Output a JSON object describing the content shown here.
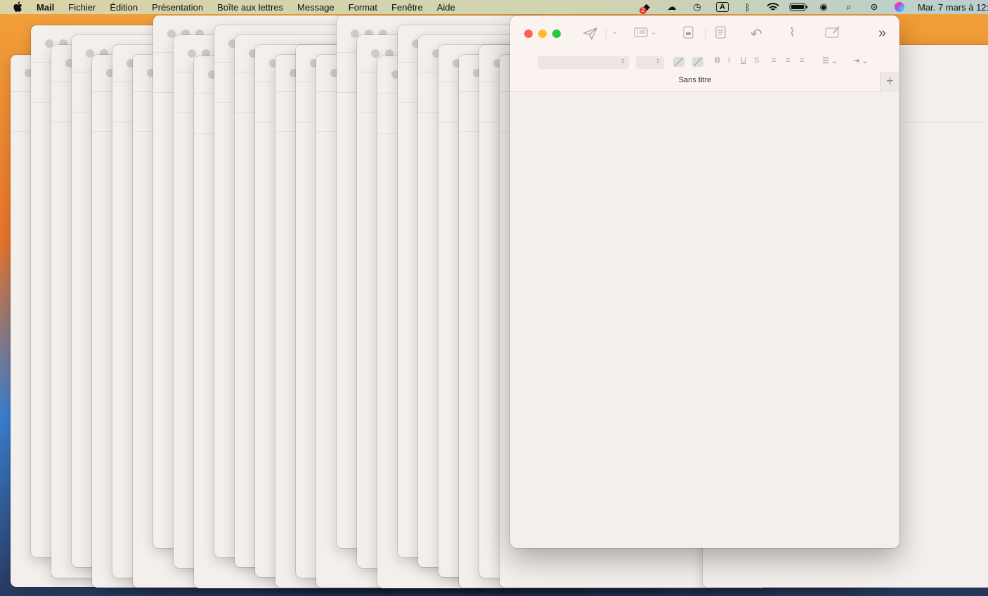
{
  "menubar": {
    "app": "Mail",
    "items": [
      "Fichier",
      "Édition",
      "Présentation",
      "Boîte aux lettres",
      "Message",
      "Format",
      "Fenêtre",
      "Aide"
    ],
    "status_icons": [
      "dropbox-icon",
      "icloud-icon",
      "time-machine-icon",
      "input-source-icon",
      "bluetooth-icon",
      "wifi-icon",
      "battery-icon",
      "user-icon",
      "spotlight-icon",
      "control-center-icon",
      "siri-icon"
    ],
    "dropbox_badge": "2",
    "input_source": "A",
    "clock": "Mar. 7 mars à 12:"
  },
  "compose": {
    "title": "Sans titre",
    "add_label": "+",
    "bold": "B",
    "italic": "I",
    "underline": "U",
    "strike": "S",
    "more": "»"
  },
  "colors": {
    "close": "#fe5f57",
    "minimize": "#febc2e",
    "zoom": "#28c840"
  }
}
